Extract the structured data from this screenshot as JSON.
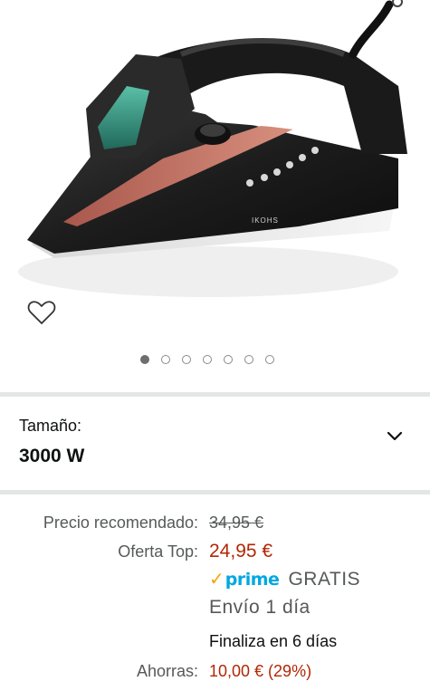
{
  "product": {
    "brand_text": "IKOHS",
    "gallery": {
      "total": 7,
      "active": 1
    }
  },
  "variant": {
    "label": "Tamaño:",
    "value": "3000 W"
  },
  "pricing": {
    "recommended_label": "Precio recomendado:",
    "recommended_value": "34,95 €",
    "offer_label": "Oferta Top:",
    "offer_value": "24,95 €",
    "prime_logo": "prime",
    "shipping_free": "GRATIS",
    "delivery": "Envío 1 día",
    "ends": "Finaliza en 6 días",
    "savings_label": "Ahorras:",
    "savings_value": "10,00 € (29%)"
  },
  "colors": {
    "price_red": "#b12704",
    "prime_blue": "#00a8e1",
    "prime_check": "#f7a300",
    "separator": "#e3e6e6"
  },
  "icons": [
    "share-icon",
    "heart-icon",
    "chevron-down-icon"
  ]
}
